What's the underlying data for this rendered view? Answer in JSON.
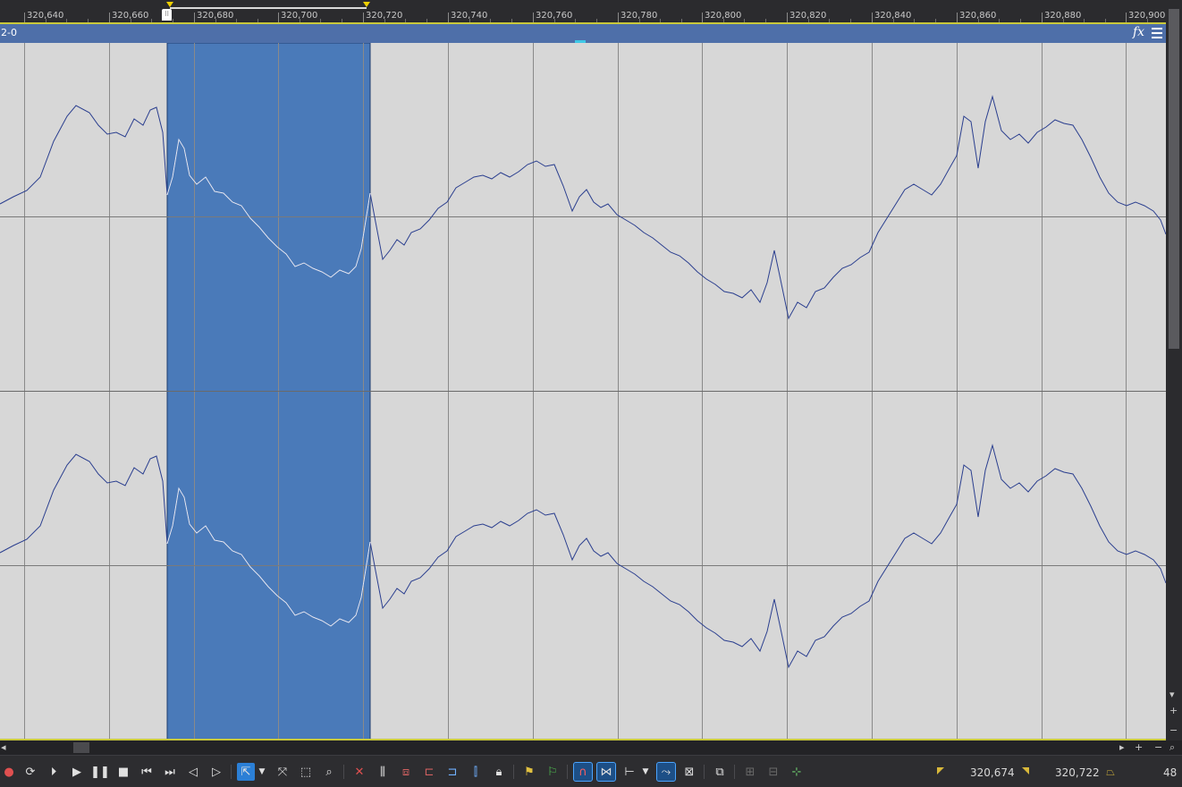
{
  "ruler": {
    "labels": [
      "320,640",
      "320,660",
      "320,680",
      "320,700",
      "320,720",
      "320,740",
      "320,760",
      "320,780",
      "320,800",
      "320,820",
      "320,840",
      "320,860",
      "320,880",
      "320,900"
    ]
  },
  "track": {
    "name": "2-0"
  },
  "selection": {
    "start": "320,674",
    "end": "320,722"
  },
  "status": {
    "right_value": "48"
  },
  "colors": {
    "waveform_bg": "#d7d7d7",
    "selection": "#4a7ab9",
    "track_header": "#4e6fa9",
    "wave_line": "#2b3f8f",
    "wave_line_selected": "#e8ecf5"
  },
  "icons": {
    "transport": [
      "record-icon",
      "loop-icon",
      "play-from-start-icon",
      "play-icon",
      "pause-icon",
      "stop-icon",
      "go-to-start-icon",
      "go-to-end-icon",
      "previous-frame-icon",
      "next-frame-icon"
    ],
    "tools": [
      "normal-edit-tool-icon",
      "envelope-tool-icon",
      "selection-tool-icon",
      "zoom-tool-icon",
      "delete-icon",
      "trim-icon",
      "split-icon",
      "trim-start-icon",
      "trim-end-icon",
      "lock-icon",
      "marker-icon",
      "region-icon",
      "snapping-icon",
      "auto-crossfade-icon",
      "ripple-edit-icon",
      "lock-envelopes-icon",
      "ignore-grouping-icon",
      "media-fx-icon",
      "event-pan-icon",
      "event-crop-icon",
      "add-track-icon"
    ]
  }
}
